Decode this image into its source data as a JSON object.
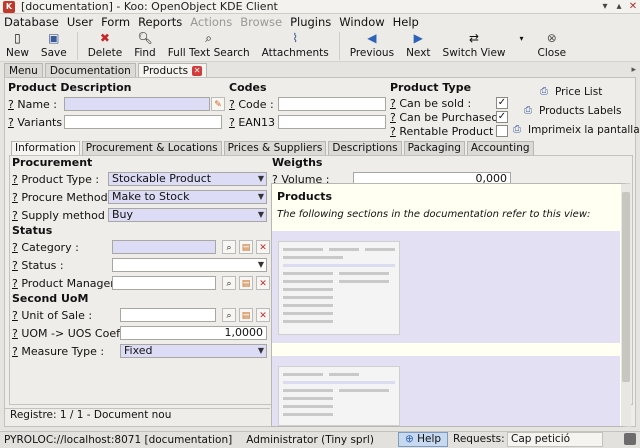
{
  "window": {
    "title": "[documentation] - Koo: OpenObject KDE Client"
  },
  "menubar": [
    "Database",
    "User",
    "Form",
    "Reports",
    "Actions",
    "Browse",
    "Plugins",
    "Window",
    "Help"
  ],
  "menubar_disabled": [
    "Actions",
    "Browse"
  ],
  "toolbar": {
    "new": "New",
    "save": "Save",
    "delete": "Delete",
    "find": "Find",
    "full_text_search": "Full Text Search",
    "attachments": "Attachments",
    "previous": "Previous",
    "next": "Next",
    "switch_view": "Switch View",
    "close": "Close"
  },
  "doc_tabs": [
    "Menu",
    "Documentation",
    "Products"
  ],
  "sections": {
    "product_description": "Product Description",
    "codes": "Codes",
    "product_type": "Product Type",
    "procurement": "Procurement",
    "weights": "Weigths",
    "status": "Status",
    "second_uom": "Second UoM"
  },
  "fields": {
    "name_label": "Name :",
    "variants_label": "Variants :",
    "code_label": "Code :",
    "ean13_label": "EAN13 :",
    "can_be_sold_label": "Can be sold :",
    "can_be_purchased_label": "Can be Purchased :",
    "rentable_label": "Rentable Product :",
    "product_type_label": "Product Type :",
    "product_type_value": "Stockable Product",
    "procure_method_label": "Procure Method :",
    "procure_method_value": "Make to Stock",
    "supply_method_label": "Supply method :",
    "supply_method_value": "Buy",
    "volume_label": "Volume :",
    "volume_value": "0,000",
    "category_label": "Category :",
    "status_label": "Status :",
    "product_manager_label": "Product Manager :",
    "unit_of_sale_label": "Unit of Sale :",
    "uom_uos_label": "UOM -> UOS Coeff :",
    "uom_uos_value": "1,0000",
    "measure_type_label": "Measure Type :",
    "measure_type_value": "Fixed"
  },
  "side_actions": [
    "Price List",
    "Products Labels",
    "Imprimeix la pantalla"
  ],
  "inner_tabs": [
    "Information",
    "Procurement & Locations",
    "Prices & Suppliers",
    "Descriptions",
    "Packaging",
    "Accounting"
  ],
  "popup": {
    "title": "Products",
    "description": "The following sections in the documentation refer to this view:"
  },
  "record_bar": "Registre: 1 / 1 - Document nou",
  "statusbar": {
    "connection": "PYROLOC://localhost:8071 [documentation]",
    "user": "Administrator (Tiny sprl)",
    "help": "Help",
    "requests_label": "Requests:",
    "requests_value": "Cap petició"
  }
}
